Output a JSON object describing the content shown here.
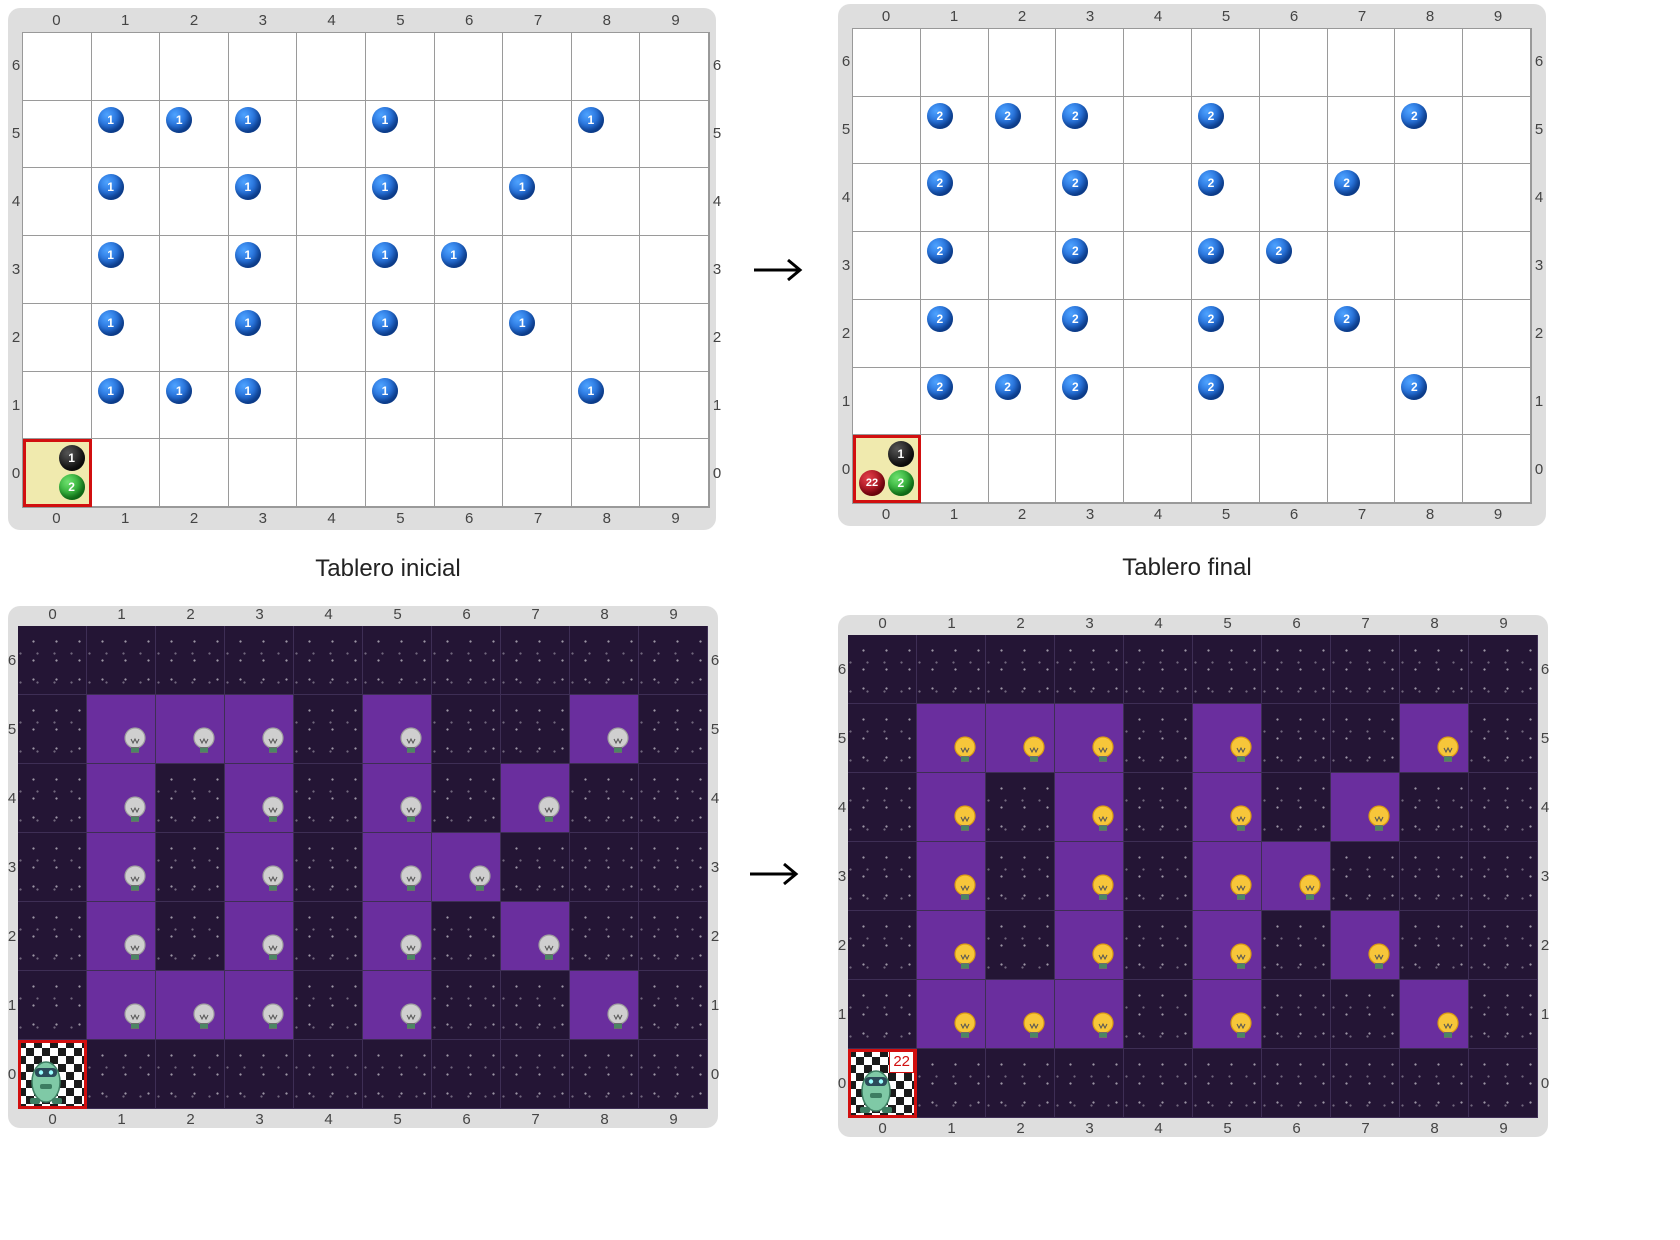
{
  "arrow_label": "→",
  "captions": {
    "initial": "Tablero inicial",
    "final": "Tablero final"
  },
  "col_labels": [
    "0",
    "1",
    "2",
    "3",
    "4",
    "5",
    "6",
    "7",
    "8",
    "9"
  ],
  "row_labels": [
    "6",
    "5",
    "4",
    "3",
    "2",
    "1",
    "0"
  ],
  "colors": {
    "highlight_border": "#d10f0f",
    "lit_cell": "#6a2e9e",
    "space": "#241535",
    "ball_blue": "#1b6fe0"
  },
  "icons": {
    "ball": "ball-icon",
    "bulb_off": "bulb-off-icon",
    "bulb_on": "bulb-on-icon",
    "robot": "robot-icon",
    "arrow": "arrow-right-icon"
  },
  "boards": {
    "initial": {
      "blue_ball_label": "1",
      "blue_balls": [
        [
          1,
          1
        ],
        [
          2,
          1
        ],
        [
          3,
          1
        ],
        [
          5,
          1
        ],
        [
          8,
          1
        ],
        [
          1,
          2
        ],
        [
          3,
          2
        ],
        [
          5,
          2
        ],
        [
          7,
          2
        ],
        [
          1,
          3
        ],
        [
          3,
          3
        ],
        [
          5,
          3
        ],
        [
          6,
          3
        ],
        [
          1,
          4
        ],
        [
          3,
          4
        ],
        [
          5,
          4
        ],
        [
          7,
          4
        ],
        [
          1,
          5
        ],
        [
          2,
          5
        ],
        [
          3,
          5
        ],
        [
          5,
          5
        ],
        [
          8,
          5
        ]
      ],
      "origin": {
        "black": "1",
        "green": "2"
      }
    },
    "final": {
      "blue_ball_label": "2",
      "blue_balls": [
        [
          1,
          1
        ],
        [
          2,
          1
        ],
        [
          3,
          1
        ],
        [
          5,
          1
        ],
        [
          8,
          1
        ],
        [
          1,
          2
        ],
        [
          3,
          2
        ],
        [
          5,
          2
        ],
        [
          7,
          2
        ],
        [
          1,
          3
        ],
        [
          3,
          3
        ],
        [
          5,
          3
        ],
        [
          6,
          3
        ],
        [
          1,
          4
        ],
        [
          3,
          4
        ],
        [
          5,
          4
        ],
        [
          7,
          4
        ],
        [
          1,
          5
        ],
        [
          2,
          5
        ],
        [
          3,
          5
        ],
        [
          5,
          5
        ],
        [
          8,
          5
        ]
      ],
      "origin": {
        "black": "1",
        "green": "2",
        "red": "22"
      }
    },
    "scene_initial": {
      "bulbs_on": false
    },
    "scene_final": {
      "bulbs_on": true,
      "counter": "22"
    }
  }
}
